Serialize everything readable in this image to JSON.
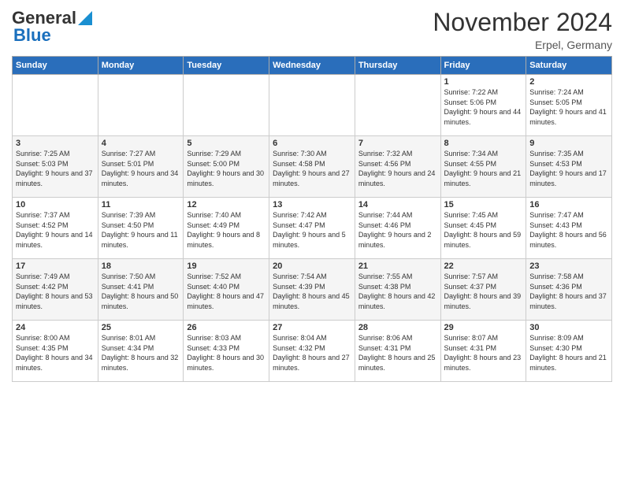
{
  "header": {
    "logo_line1": "General",
    "logo_line2": "Blue",
    "month_title": "November 2024",
    "location": "Erpel, Germany"
  },
  "days_of_week": [
    "Sunday",
    "Monday",
    "Tuesday",
    "Wednesday",
    "Thursday",
    "Friday",
    "Saturday"
  ],
  "weeks": [
    [
      {
        "day": "",
        "info": ""
      },
      {
        "day": "",
        "info": ""
      },
      {
        "day": "",
        "info": ""
      },
      {
        "day": "",
        "info": ""
      },
      {
        "day": "",
        "info": ""
      },
      {
        "day": "1",
        "info": "Sunrise: 7:22 AM\nSunset: 5:06 PM\nDaylight: 9 hours and 44 minutes."
      },
      {
        "day": "2",
        "info": "Sunrise: 7:24 AM\nSunset: 5:05 PM\nDaylight: 9 hours and 41 minutes."
      }
    ],
    [
      {
        "day": "3",
        "info": "Sunrise: 7:25 AM\nSunset: 5:03 PM\nDaylight: 9 hours and 37 minutes."
      },
      {
        "day": "4",
        "info": "Sunrise: 7:27 AM\nSunset: 5:01 PM\nDaylight: 9 hours and 34 minutes."
      },
      {
        "day": "5",
        "info": "Sunrise: 7:29 AM\nSunset: 5:00 PM\nDaylight: 9 hours and 30 minutes."
      },
      {
        "day": "6",
        "info": "Sunrise: 7:30 AM\nSunset: 4:58 PM\nDaylight: 9 hours and 27 minutes."
      },
      {
        "day": "7",
        "info": "Sunrise: 7:32 AM\nSunset: 4:56 PM\nDaylight: 9 hours and 24 minutes."
      },
      {
        "day": "8",
        "info": "Sunrise: 7:34 AM\nSunset: 4:55 PM\nDaylight: 9 hours and 21 minutes."
      },
      {
        "day": "9",
        "info": "Sunrise: 7:35 AM\nSunset: 4:53 PM\nDaylight: 9 hours and 17 minutes."
      }
    ],
    [
      {
        "day": "10",
        "info": "Sunrise: 7:37 AM\nSunset: 4:52 PM\nDaylight: 9 hours and 14 minutes."
      },
      {
        "day": "11",
        "info": "Sunrise: 7:39 AM\nSunset: 4:50 PM\nDaylight: 9 hours and 11 minutes."
      },
      {
        "day": "12",
        "info": "Sunrise: 7:40 AM\nSunset: 4:49 PM\nDaylight: 9 hours and 8 minutes."
      },
      {
        "day": "13",
        "info": "Sunrise: 7:42 AM\nSunset: 4:47 PM\nDaylight: 9 hours and 5 minutes."
      },
      {
        "day": "14",
        "info": "Sunrise: 7:44 AM\nSunset: 4:46 PM\nDaylight: 9 hours and 2 minutes."
      },
      {
        "day": "15",
        "info": "Sunrise: 7:45 AM\nSunset: 4:45 PM\nDaylight: 8 hours and 59 minutes."
      },
      {
        "day": "16",
        "info": "Sunrise: 7:47 AM\nSunset: 4:43 PM\nDaylight: 8 hours and 56 minutes."
      }
    ],
    [
      {
        "day": "17",
        "info": "Sunrise: 7:49 AM\nSunset: 4:42 PM\nDaylight: 8 hours and 53 minutes."
      },
      {
        "day": "18",
        "info": "Sunrise: 7:50 AM\nSunset: 4:41 PM\nDaylight: 8 hours and 50 minutes."
      },
      {
        "day": "19",
        "info": "Sunrise: 7:52 AM\nSunset: 4:40 PM\nDaylight: 8 hours and 47 minutes."
      },
      {
        "day": "20",
        "info": "Sunrise: 7:54 AM\nSunset: 4:39 PM\nDaylight: 8 hours and 45 minutes."
      },
      {
        "day": "21",
        "info": "Sunrise: 7:55 AM\nSunset: 4:38 PM\nDaylight: 8 hours and 42 minutes."
      },
      {
        "day": "22",
        "info": "Sunrise: 7:57 AM\nSunset: 4:37 PM\nDaylight: 8 hours and 39 minutes."
      },
      {
        "day": "23",
        "info": "Sunrise: 7:58 AM\nSunset: 4:36 PM\nDaylight: 8 hours and 37 minutes."
      }
    ],
    [
      {
        "day": "24",
        "info": "Sunrise: 8:00 AM\nSunset: 4:35 PM\nDaylight: 8 hours and 34 minutes."
      },
      {
        "day": "25",
        "info": "Sunrise: 8:01 AM\nSunset: 4:34 PM\nDaylight: 8 hours and 32 minutes."
      },
      {
        "day": "26",
        "info": "Sunrise: 8:03 AM\nSunset: 4:33 PM\nDaylight: 8 hours and 30 minutes."
      },
      {
        "day": "27",
        "info": "Sunrise: 8:04 AM\nSunset: 4:32 PM\nDaylight: 8 hours and 27 minutes."
      },
      {
        "day": "28",
        "info": "Sunrise: 8:06 AM\nSunset: 4:31 PM\nDaylight: 8 hours and 25 minutes."
      },
      {
        "day": "29",
        "info": "Sunrise: 8:07 AM\nSunset: 4:31 PM\nDaylight: 8 hours and 23 minutes."
      },
      {
        "day": "30",
        "info": "Sunrise: 8:09 AM\nSunset: 4:30 PM\nDaylight: 8 hours and 21 minutes."
      }
    ]
  ]
}
